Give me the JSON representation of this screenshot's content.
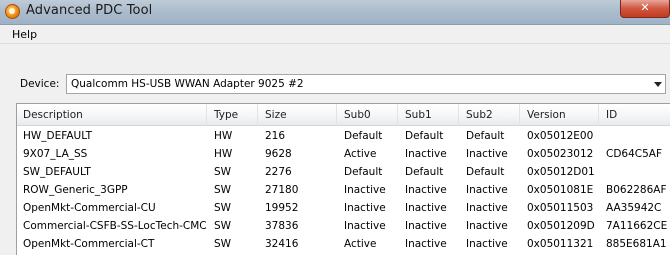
{
  "window": {
    "title": "Advanced PDC Tool",
    "close_glyph": "✕"
  },
  "menu": {
    "items": [
      {
        "label": "Help"
      }
    ]
  },
  "device": {
    "label": "Device:",
    "selected": "Qualcomm HS-USB WWAN Adapter 9025 #2"
  },
  "table": {
    "columns": [
      "Description",
      "Type",
      "Size",
      "Sub0",
      "Sub1",
      "Sub2",
      "Version",
      "ID"
    ],
    "rows": [
      [
        "HW_DEFAULT",
        "HW",
        "216",
        "Default",
        "Default",
        "Default",
        "0x05012E00",
        ""
      ],
      [
        "9X07_LA_SS",
        "HW",
        "9628",
        "Active",
        "Inactive",
        "Inactive",
        "0x05023012",
        "CD64C5AF"
      ],
      [
        "SW_DEFAULT",
        "SW",
        "2276",
        "Default",
        "Default",
        "Default",
        "0x05012D01",
        ""
      ],
      [
        "ROW_Generic_3GPP",
        "SW",
        "27180",
        "Inactive",
        "Inactive",
        "Inactive",
        "0x0501081E",
        "B062286AF"
      ],
      [
        "OpenMkt-Commercial-CU",
        "SW",
        "19952",
        "Inactive",
        "Inactive",
        "Inactive",
        "0x05011503",
        "AA35942C"
      ],
      [
        "Commercial-CSFB-SS-LocTech-CMCC",
        "SW",
        "37836",
        "Inactive",
        "Inactive",
        "Inactive",
        "0x0501209D",
        "7A11662CE"
      ],
      [
        "OpenMkt-Commercial-CT",
        "SW",
        "32416",
        "Active",
        "Inactive",
        "Inactive",
        "0x05011321",
        "885E681A1"
      ]
    ]
  }
}
